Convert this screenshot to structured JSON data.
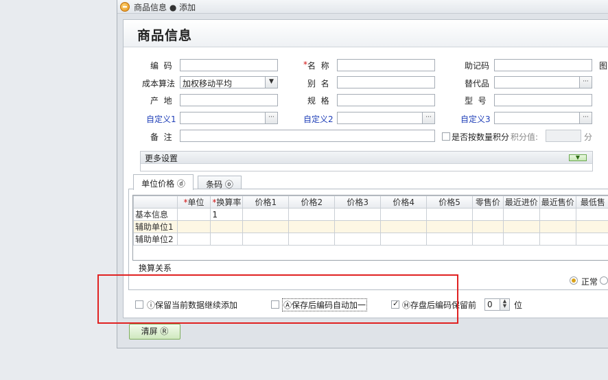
{
  "window": {
    "title": "商品信息 ● 添加"
  },
  "header": {
    "title": "商品信息"
  },
  "form": {
    "code_label": "编  码",
    "name_label": "名  称",
    "mnemonic_label": "助记码",
    "image_label": "图",
    "cost_label": "成本算法",
    "cost_value": "加权移动平均",
    "alias_label": "别  名",
    "substitute_label": "替代品",
    "origin_label": "产  地",
    "spec_label": "规  格",
    "model_label": "型  号",
    "custom1_label": "自定义1",
    "custom2_label": "自定义2",
    "custom3_label": "自定义3",
    "remark_label": "备  注",
    "points_checkbox_label": "是否按数量积分",
    "points_value_label": "积分值:",
    "points_unit": "分",
    "required_mark": "*"
  },
  "more_settings": {
    "label": "更多设置"
  },
  "tabs": [
    {
      "label": "单位价格 ⓓ"
    },
    {
      "label": "条码 ⓞ"
    }
  ],
  "grid": {
    "columns": [
      "",
      "单位",
      "换算率",
      "价格1",
      "价格2",
      "价格3",
      "价格4",
      "价格5",
      "零售价",
      "最近进价",
      "最近售价",
      "最低售"
    ],
    "required_columns": [
      1,
      2
    ],
    "rows": [
      [
        "基本信息",
        "",
        "1",
        "",
        "",
        "",
        "",
        "",
        "",
        "",
        "",
        ""
      ],
      [
        "辅助单位1",
        "",
        "",
        "",
        "",
        "",
        "",
        "",
        "",
        "",
        "",
        ""
      ],
      [
        "辅助单位2",
        "",
        "",
        "",
        "",
        "",
        "",
        "",
        "",
        "",
        "",
        ""
      ]
    ]
  },
  "conversion_label": "换算关系",
  "status": {
    "normal_label": "正常"
  },
  "options": {
    "keep_data_label": "ⓘ保留当前数据继续添加",
    "auto_increment_label": "Ⓐ保存后编码自动加一",
    "keep_prefix_label": "Ⓗ存盘后编码保留前",
    "keep_prefix_value": "0",
    "keep_prefix_unit": "位"
  },
  "buttons": {
    "clear_label": "清屏 Ⓡ"
  },
  "colors": {
    "highlight_box": "#e02020",
    "required": "#d01010",
    "custom_label": "#1f3fb8"
  }
}
